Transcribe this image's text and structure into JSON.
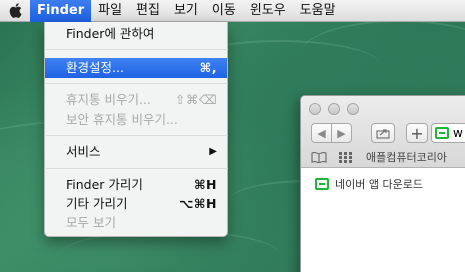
{
  "menubar": {
    "apple_icon": "apple-logo-icon",
    "items": [
      "Finder",
      "파일",
      "편집",
      "보기",
      "이동",
      "윈도우",
      "도움말"
    ]
  },
  "finder_menu": {
    "about": "Finder에 관하여",
    "preferences": {
      "label": "환경설정...",
      "shortcut": "⌘,"
    },
    "empty_trash": {
      "label": "휴지통 비우기...",
      "shortcut": "⇧⌘⌫"
    },
    "secure_empty_trash": {
      "label": "보안 휴지통 비우기..."
    },
    "services": {
      "label": "서비스",
      "arrow": "▶"
    },
    "hide_finder": {
      "label": "Finder 가리기",
      "shortcut": "⌘H"
    },
    "hide_others": {
      "label": "기타 가리기",
      "shortcut": "⌥⌘H"
    },
    "show_all": {
      "label": "모두 보기"
    }
  },
  "safari": {
    "address_prefix": "w",
    "bookmarks": [
      "애플컴퓨터코리아"
    ],
    "page_link": "네이버 앱 다운로드"
  },
  "colors": {
    "highlight": "#1f62e4",
    "desktop_green": "#2f7b5a",
    "naver_green": "#1eb53a"
  }
}
